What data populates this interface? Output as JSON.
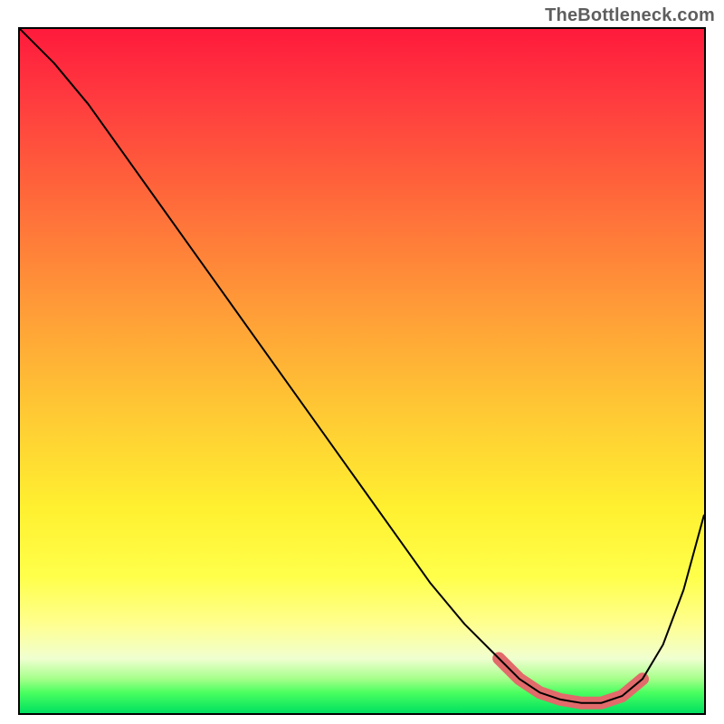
{
  "attribution": "TheBottleneck.com",
  "colors": {
    "curve": "#000000",
    "highlight": "#e26a6a",
    "border": "#000000"
  },
  "chart_data": {
    "type": "line",
    "title": "",
    "xlabel": "",
    "ylabel": "",
    "xlim": [
      0,
      100
    ],
    "ylim": [
      0,
      100
    ],
    "series": [
      {
        "name": "bottleneck-curve",
        "x": [
          0,
          5,
          10,
          15,
          20,
          25,
          30,
          35,
          40,
          45,
          50,
          55,
          60,
          65,
          70,
          73,
          76,
          79,
          82,
          85,
          88,
          91,
          94,
          97,
          100
        ],
        "y": [
          100,
          95,
          89,
          82,
          75,
          68,
          61,
          54,
          47,
          40,
          33,
          26,
          19,
          13,
          8,
          5,
          3,
          2,
          1.5,
          1.5,
          2.5,
          5,
          10,
          18,
          29
        ]
      }
    ],
    "highlight_range": {
      "name": "optimal-range",
      "x_start": 70,
      "x_end": 91
    },
    "annotations": []
  }
}
